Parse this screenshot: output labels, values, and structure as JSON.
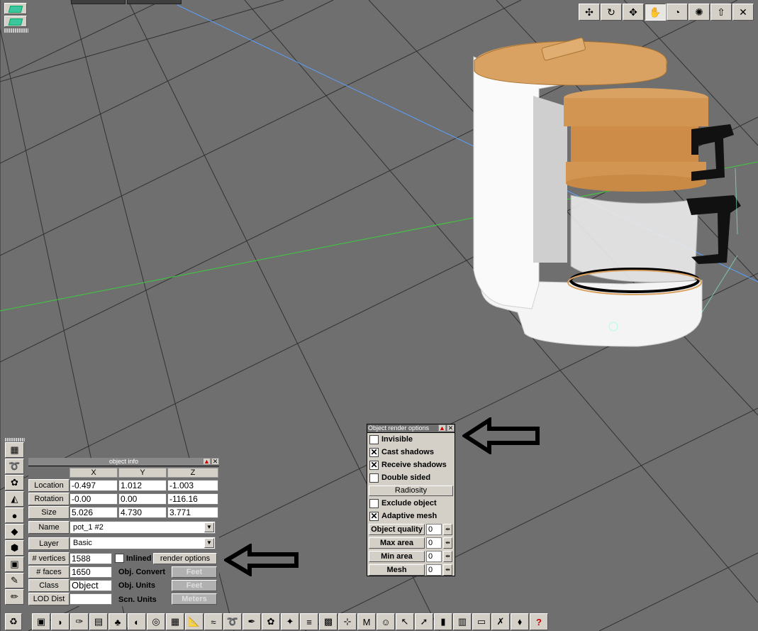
{
  "toolbar_top": [
    {
      "icon": "axis-move-icon"
    },
    {
      "icon": "rotate-icon"
    },
    {
      "icon": "scale-axes-icon"
    },
    {
      "icon": "hand-tool-icon",
      "active": true
    },
    {
      "icon": "orbit-icon"
    },
    {
      "icon": "star-burst-icon"
    },
    {
      "icon": "up-arrow-icon"
    },
    {
      "icon": "close-icon"
    }
  ],
  "object_info": {
    "title": "object info",
    "columns": [
      "X",
      "Y",
      "Z"
    ],
    "location": {
      "label": "Location",
      "x": "-0.497",
      "y": "1.012",
      "z": "-1.003"
    },
    "rotation": {
      "label": "Rotation",
      "x": "-0.00",
      "y": "0.00",
      "z": "-116.16"
    },
    "size": {
      "label": "Size",
      "x": "5.026",
      "y": "4.730",
      "z": "3.771"
    },
    "name": {
      "label": "Name",
      "value": "pot_1 #2"
    },
    "layer": {
      "label": "Layer",
      "value": "Basic"
    },
    "vertices": {
      "label": "# vertices",
      "value": "1588"
    },
    "faces": {
      "label": "# faces",
      "value": "1650"
    },
    "class": {
      "label": "Class",
      "value": "Object"
    },
    "lod": {
      "label": "LOD Dist",
      "value": ""
    },
    "inlined_label": "Inlined",
    "render_options_label": "render options",
    "obj_convert_label": "Obj. Convert",
    "obj_convert_value": "Feet",
    "obj_units_label": "Obj. Units",
    "obj_units_value": "Feet",
    "scn_units_label": "Scn. Units",
    "scn_units_value": "Meters"
  },
  "render_options": {
    "title": "Object render options",
    "invisible": {
      "label": "Invisible",
      "checked": false
    },
    "cast_shadows": {
      "label": "Cast shadows",
      "checked": true
    },
    "receive_shadows": {
      "label": "Receive shadows",
      "checked": true
    },
    "double_sided": {
      "label": "Double sided",
      "checked": false
    },
    "radiosity_label": "Radiosity",
    "exclude_object": {
      "label": "Exclude object",
      "checked": false
    },
    "adaptive_mesh": {
      "label": "Adaptive mesh",
      "checked": true
    },
    "object_quality": {
      "label": "Object quality",
      "value": "0"
    },
    "max_area": {
      "label": "Max area",
      "value": "0"
    },
    "min_area": {
      "label": "Min area",
      "value": "0"
    },
    "mesh": {
      "label": "Mesh",
      "value": "0"
    }
  },
  "colors": {
    "viewport_bg": "#6f6f6f",
    "grid": "#000000",
    "axis_blue": "#5aa0ff",
    "axis_green": "#3ccf3c",
    "wood": "#d9a262",
    "panel_bg": "#d4d0c8"
  }
}
